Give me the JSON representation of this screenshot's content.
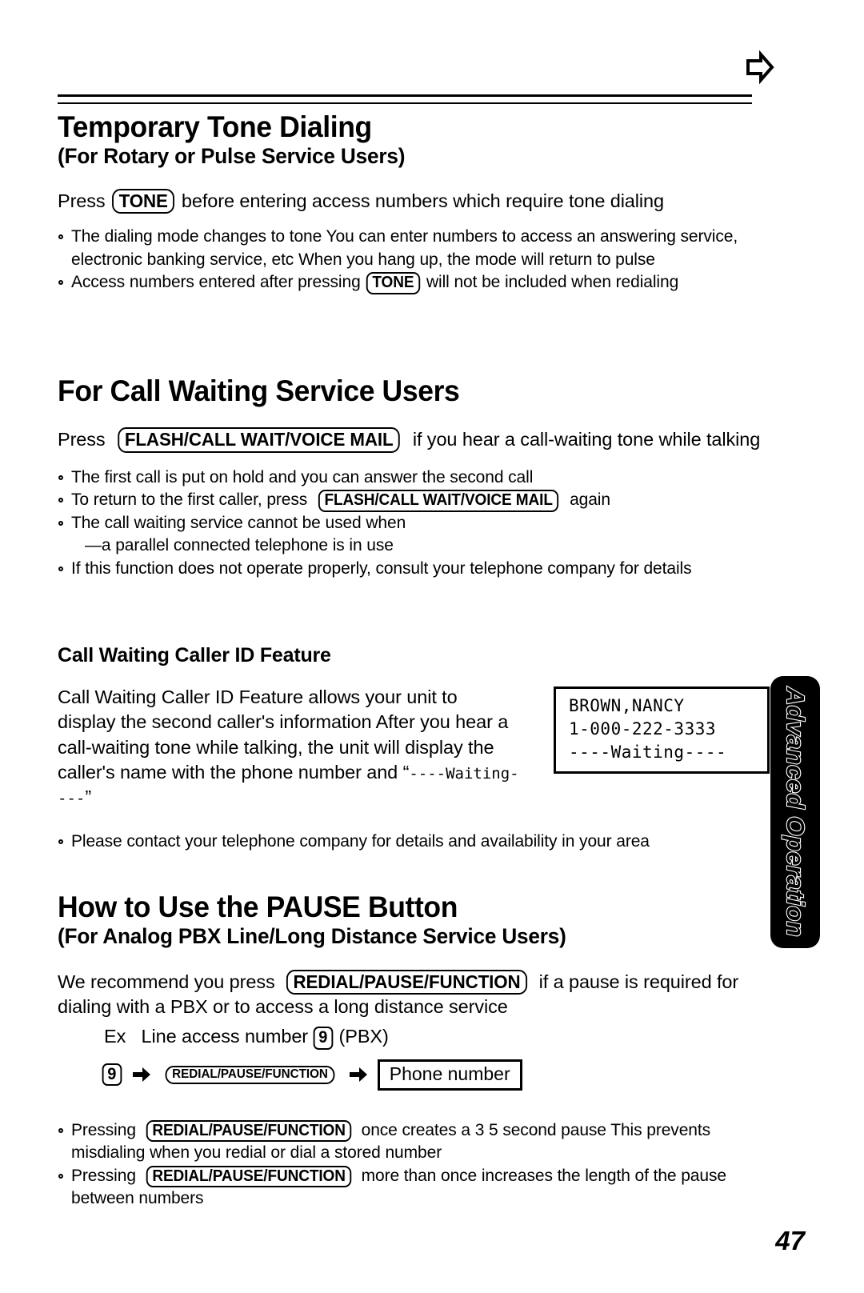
{
  "page": {
    "number": "47",
    "side_tab_label": "Advanced Operation",
    "top_marker_icon": "right-arrow-outline-icon"
  },
  "sections": [
    {
      "id": "temporary-tone-dialing",
      "title": "Temporary Tone Dialing",
      "subtitle": "(For Rotary or Pulse Service Users)",
      "lead": {
        "before": "Press",
        "key": "TONE",
        "after": "before entering access numbers which require tone dialing"
      },
      "bullets": [
        {
          "text": "The dialing mode changes to tone  You can enter numbers to access an answering service, electronic banking service, etc  When you hang up, the mode will return to pulse"
        },
        {
          "before": "Access numbers entered after pressing",
          "key": "TONE",
          "after": "will not be included when redialing"
        }
      ]
    },
    {
      "id": "for-call-waiting-service-users",
      "title": "For Call Waiting Service Users",
      "lead": {
        "before": "Press",
        "key": "FLASH/CALL WAIT/VOICE MAIL",
        "after": "if you hear a call-waiting tone while talking"
      },
      "bullets": [
        {
          "text": "The first call is put on hold and you can answer the second call"
        },
        {
          "before": "To return to the first caller, press",
          "key": "FLASH/CALL WAIT/VOICE MAIL",
          "after": "again"
        },
        {
          "text": "The call waiting service cannot be used when"
        },
        {
          "text": "—a parallel connected telephone is in use",
          "no_bullet": true
        },
        {
          "text": "If this function does not operate properly, consult your telephone company for details"
        }
      ]
    },
    {
      "id": "call-waiting-caller-id-feature",
      "title": "Call Waiting Caller ID Feature",
      "paragraph_parts": {
        "p1": "Call Waiting Caller ID Feature allows your unit to display the second caller's information  After you hear a call-waiting tone while talking, the unit will display the caller's name with the phone number and “",
        "mono": "----Waiting----",
        "p2": "”"
      },
      "lcd": {
        "line1": "BROWN,NANCY",
        "line2": "1-000-222-3333",
        "line3": "----Waiting----"
      },
      "bullets": [
        {
          "text": "Please contact your telephone company for details and availability in your area"
        }
      ]
    },
    {
      "id": "how-to-use-the-pause-button",
      "title": "How to Use the PAUSE Button",
      "subtitle": "(For Analog PBX Line/Long Distance Service Users)",
      "lead": {
        "before": "We recommend you press",
        "key": "REDIAL/PAUSE/FUNCTION",
        "after": "if a pause is required for dialing with a PBX or to access a long distance service"
      },
      "example": {
        "prefix": "Ex",
        "text": "Line access number",
        "key": "9",
        "suffix": "(PBX)"
      },
      "flow": {
        "step1_key": "9",
        "arrow": "right-arrow-icon",
        "step2_key": "REDIAL/PAUSE/FUNCTION",
        "step3_box": "Phone number"
      },
      "bullets": [
        {
          "before": "Pressing",
          "key": "REDIAL/PAUSE/FUNCTION",
          "after": "once creates a 3 5 second pause  This prevents misdialing when you redial or dial a stored number"
        },
        {
          "before": "Pressing",
          "key": "REDIAL/PAUSE/FUNCTION",
          "after": "more than once increases the length of the pause between numbers"
        }
      ]
    }
  ]
}
